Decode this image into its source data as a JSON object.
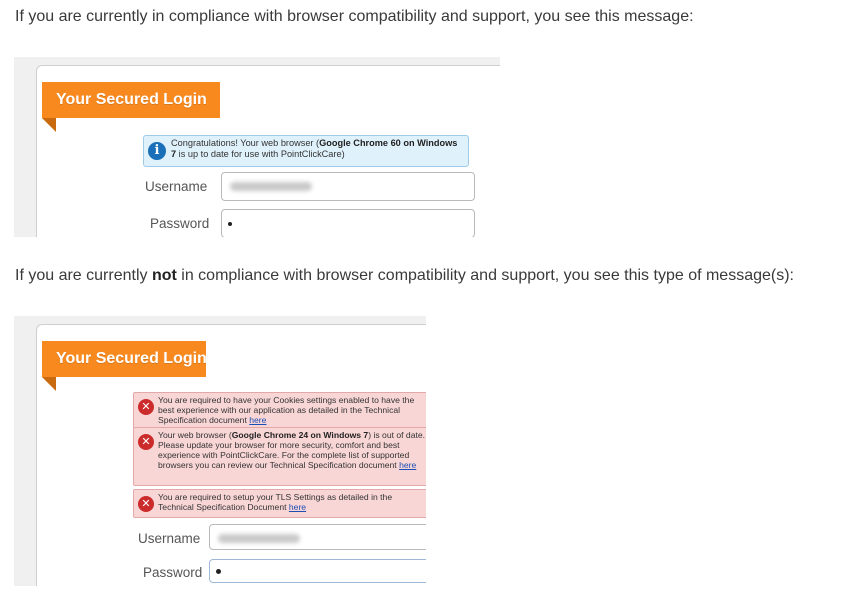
{
  "paragraph1": "If you are currently in compliance with browser compatibility and support, you see this message:",
  "paragraph2": {
    "before": "If you are currently ",
    "bold": "not",
    "after": " in compliance with browser compatibility and support, you see this type of message(s):"
  },
  "shot1": {
    "banner": "Your Secured Login",
    "info": {
      "prefix": "Congratulations! Your web browser (",
      "bold": "Google Chrome 60 on Windows 7",
      "suffix": " is up to date for use with PointClickCare)"
    },
    "username_label": "Username",
    "password_label": "Password"
  },
  "shot2": {
    "banner": "Your Secured Login",
    "errors": [
      {
        "text": "You are required to have your Cookies settings enabled to have the best experience with our application as detailed in the Technical Specification document ",
        "link": "here"
      },
      {
        "prefix": "Your web browser (",
        "bold": "Google Chrome 24 on Windows 7",
        "suffix": ") is out of date. Please update your browser for more security, comfort and best experience with PointClickCare. For the complete list of supported browsers you can review our Technical Specification document ",
        "link": "here"
      },
      {
        "text": "You are required to setup your TLS Settings as detailed in the Technical Specification Document ",
        "link": "here"
      }
    ],
    "username_label": "Username",
    "password_label": "Password"
  },
  "colors": {
    "banner": "#f7891f",
    "info_bg": "#dff1fb",
    "error_bg": "#f9d6d6",
    "error_icon": "#cc2b2b",
    "info_icon": "#1a70b8"
  },
  "icons": {
    "info": "info-circle-icon",
    "error": "error-x-icon"
  }
}
